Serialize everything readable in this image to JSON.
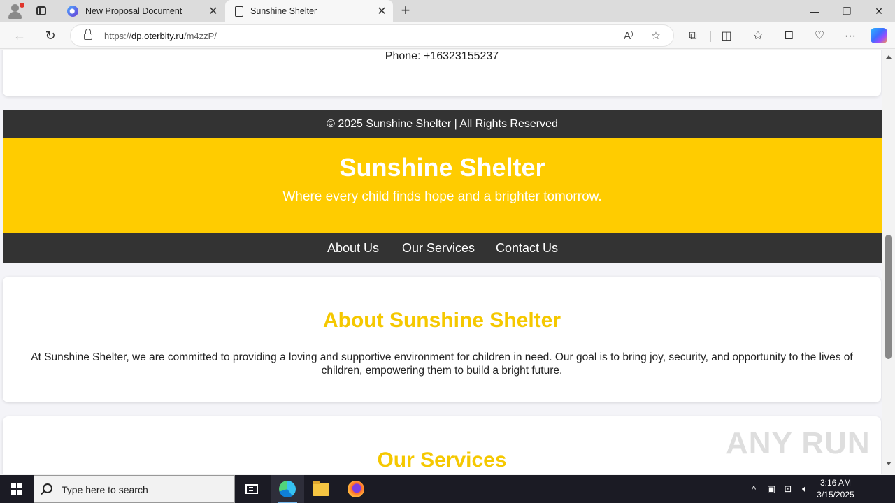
{
  "browser": {
    "tabs": [
      {
        "title": "New Proposal Document",
        "active": false
      },
      {
        "title": "Sunshine Shelter",
        "active": true
      }
    ],
    "address": {
      "scheme": "https://",
      "host": "dp.oterbity.ru",
      "path": "/m4zzP/"
    }
  },
  "page": {
    "phone": "Phone: +16323155237",
    "footer": "© 2025 Sunshine Shelter | All Rights Reserved",
    "header": {
      "title": "Sunshine Shelter",
      "tagline": "Where every child finds hope and a brighter tomorrow."
    },
    "nav": [
      "About Us",
      "Our Services",
      "Contact Us"
    ],
    "about": {
      "heading": "About Sunshine Shelter",
      "text": "At Sunshine Shelter, we are committed to providing a loving and supportive environment for children in need. Our goal is to bring joy, security, and opportunity to the lives of children, empowering them to build a bright future."
    },
    "services": {
      "heading": "Our Services"
    },
    "watermark": "ANY RUN",
    "colors": {
      "header_yellow": "#ffcc00",
      "heading_yellow": "#f5c800",
      "dark_bar": "#333333"
    }
  },
  "taskbar": {
    "search_placeholder": "Type here to search",
    "time": "3:16 AM",
    "date": "3/15/2025"
  }
}
